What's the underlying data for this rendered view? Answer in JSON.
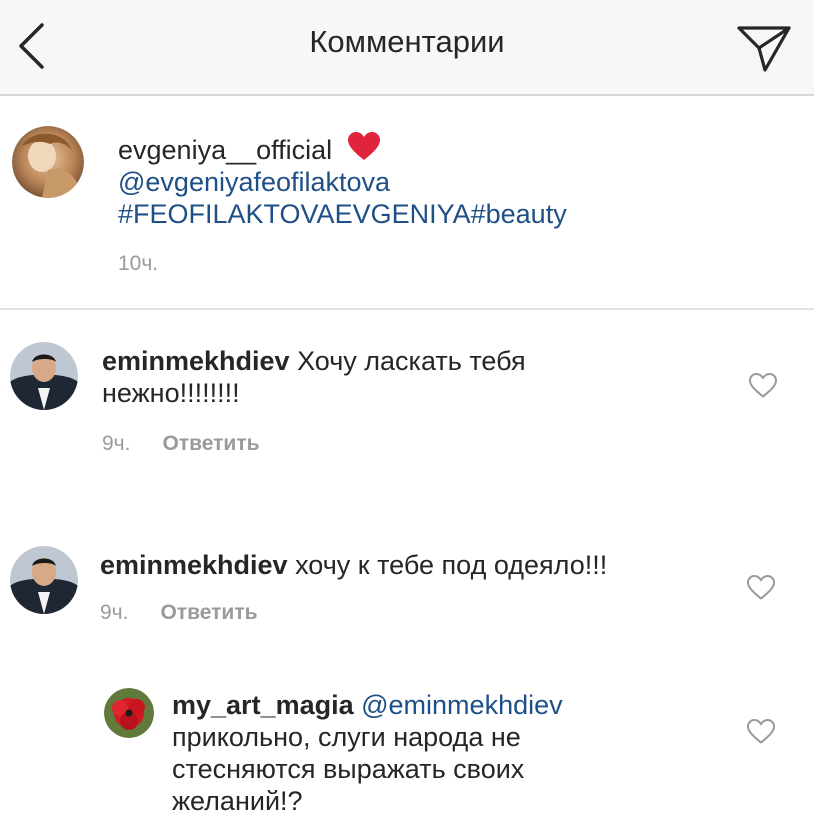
{
  "header": {
    "title": "Комментарии",
    "back_icon": "chevron-left-icon",
    "send_icon": "paper-plane-icon"
  },
  "caption": {
    "username": "evgeniya__official",
    "emoji": "heart-emoji-icon",
    "mention": "@evgeniyafeofilaktova",
    "hashtags": "#FEOFILAKTOVAEVGENIYA#beauty",
    "time": "10ч."
  },
  "comments": [
    {
      "username": "eminmekhdiev",
      "text_line1": "Хочу ласкать тебя",
      "text_line2": "нежно!!!!!!!!",
      "time": "9ч.",
      "reply_label": "Ответить"
    },
    {
      "username": "eminmekhdiev",
      "text_line1": "хочу к тебе под одеяло!!!",
      "time": "9ч.",
      "reply_label": "Ответить"
    }
  ],
  "reply": {
    "username": "my_art_magia",
    "mention": "@eminmekhdiev",
    "text_line1": "прикольно, слуги народа не",
    "text_line2": "стесняются выражать своих",
    "text_line3": "желаний!?"
  },
  "colors": {
    "link_blue": "#1e4f86",
    "meta_gray": "#9a9a9a",
    "heart_red": "#e0243b"
  }
}
